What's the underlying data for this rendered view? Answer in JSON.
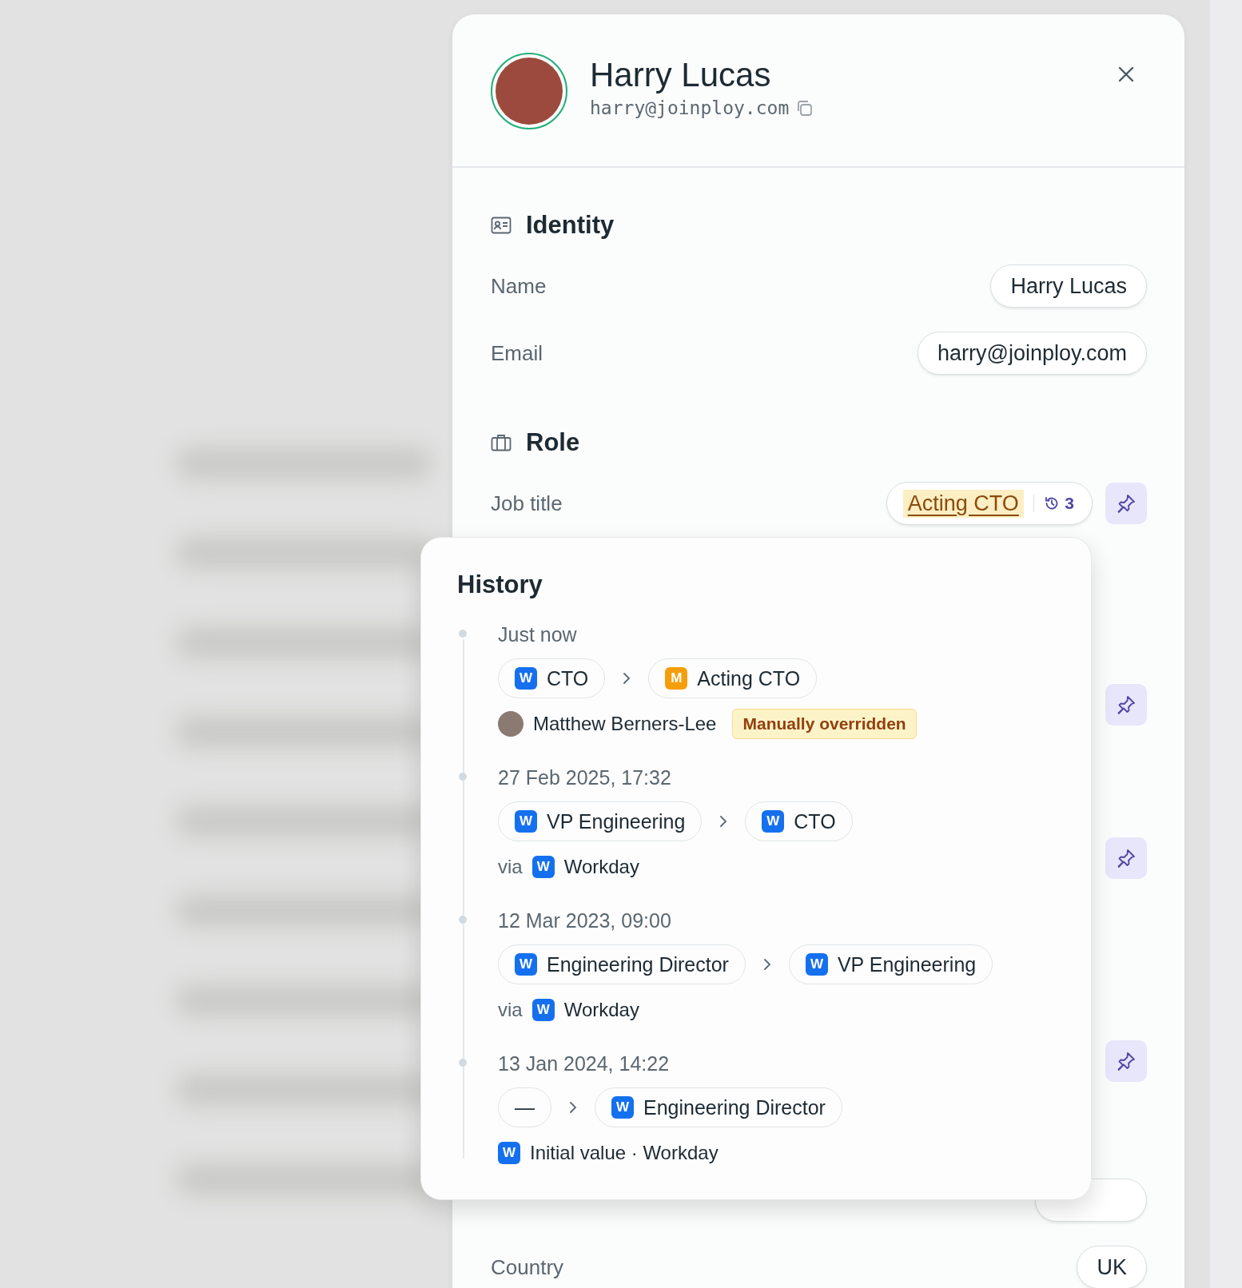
{
  "profile": {
    "name": "Harry Lucas",
    "email": "harry@joinploy.com"
  },
  "sections": [
    {
      "kind": "identity",
      "title": "Identity",
      "fields": [
        {
          "label": "Name",
          "value": "Harry Lucas"
        },
        {
          "label": "Email",
          "value": "harry@joinploy.com"
        }
      ]
    },
    {
      "kind": "role",
      "title": "Role",
      "fields": [
        {
          "label": "Job title",
          "value": "Acting CTO",
          "history_count": "3",
          "overridden": true
        }
      ]
    }
  ],
  "location_fields": [
    {
      "label": "Country",
      "value": "UK"
    }
  ],
  "history": {
    "title": "History",
    "entries": [
      {
        "time": "Just now",
        "from": {
          "badge": "W",
          "color": "#1570ef",
          "label": "CTO"
        },
        "to": {
          "badge": "M",
          "color": "#f59e0b",
          "label": "Acting CTO"
        },
        "footer": {
          "kind": "user",
          "name": "Matthew Berners-Lee",
          "tag": "Manually overridden"
        }
      },
      {
        "time": "27 Feb 2025, 17:32",
        "from": {
          "badge": "W",
          "color": "#1570ef",
          "label": "VP Engineering"
        },
        "to": {
          "badge": "W",
          "color": "#1570ef",
          "label": "CTO"
        },
        "footer": {
          "kind": "via",
          "prefix": "via",
          "badge": "W",
          "color": "#1570ef",
          "source": "Workday"
        }
      },
      {
        "time": "12 Mar 2023, 09:00",
        "from": {
          "badge": "W",
          "color": "#1570ef",
          "label": "Engineering Director"
        },
        "to": {
          "badge": "W",
          "color": "#1570ef",
          "label": "VP Engineering"
        },
        "footer": {
          "kind": "via",
          "prefix": "via",
          "badge": "W",
          "color": "#1570ef",
          "source": "Workday"
        }
      },
      {
        "time": "13 Jan 2024, 14:22",
        "from": {
          "label": "—"
        },
        "to": {
          "badge": "W",
          "color": "#1570ef",
          "label": "Engineering Director"
        },
        "footer": {
          "kind": "initial",
          "badge": "W",
          "color": "#1570ef",
          "text": "Initial value · Workday"
        }
      }
    ]
  }
}
